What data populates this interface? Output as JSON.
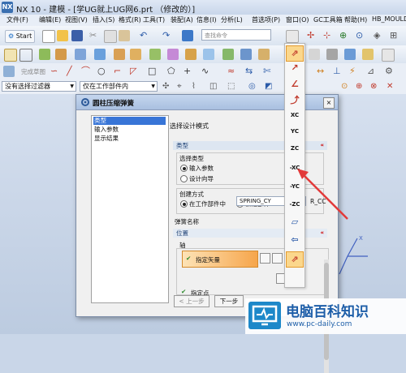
{
  "window": {
    "app_icon_text": "NX",
    "title": "NX 10 - 建模 - [学UG就上UG网6.prt （修改的）]"
  },
  "menu": [
    "文件(F)",
    "编辑(E)",
    "视图(V)",
    "插入(S)",
    "格式(R)",
    "工具(T)",
    "装配(A)",
    "信息(I)",
    "分析(L)",
    "首选项(P)",
    "窗口(O)",
    "GC工具箱",
    "帮助(H)",
    "HB_MOULD"
  ],
  "toolbar": {
    "start_label": "Start",
    "search_placeholder": "查找命令",
    "smart_completion": "完成草图",
    "filter_select": "没有选择过滤器",
    "scope_select": "仅在工作部件内"
  },
  "dialog": {
    "title": "圆柱压缩弹簧",
    "close_glyph": "×",
    "nav_items": [
      "类型",
      "输入参数",
      "显示结果"
    ],
    "nav_selected_index": 0,
    "step_title": "选择设计模式",
    "type_section": "类型",
    "select_type_label": "选择类型",
    "type_options": [
      "输入参数",
      "设计向导"
    ],
    "type_selected_index": 0,
    "create_mode_label": "创建方式",
    "create_options": [
      "在工作部件中",
      "新建部件"
    ],
    "create_selected_index": 0,
    "spring_name_label": "弹簧名称",
    "spring_name_value": "SPRING_CY",
    "spring_name_tail": "R_CC",
    "position_section": "位置",
    "axis_label": "轴",
    "specify_vector": "指定矢量",
    "specify_point": "指定点",
    "buttons": {
      "prev": "< 上一步",
      "next": "下一步"
    }
  },
  "vector_flyout": [
    "XC",
    "YC",
    "ZC",
    "-XC",
    "-YC",
    "-ZC"
  ],
  "watermark": {
    "title": "电脑百科知识",
    "url": "www.pc-daily.com"
  },
  "colors": {
    "accent": "#f6a54b",
    "selection": "#3875d7",
    "arrow": "#e23a3a",
    "dialog_header": "#a9c0e0"
  }
}
